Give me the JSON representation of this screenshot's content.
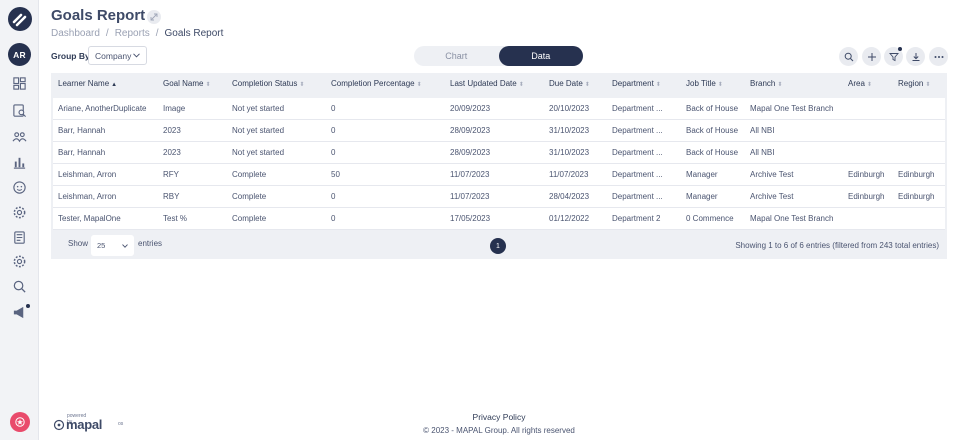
{
  "sidebar": {
    "avatar_initials": "AR",
    "icons": [
      "dashboard-icon",
      "report-search-icon",
      "people-icon",
      "bar-chart-icon",
      "face-icon",
      "settings-icon",
      "document-icon",
      "settings-alt-icon",
      "search-icon",
      "megaphone-icon"
    ]
  },
  "header": {
    "title": "Goals Report",
    "breadcrumb": [
      "Dashboard",
      "Reports",
      "Goals Report"
    ]
  },
  "toolbar": {
    "group_by_label": "Group By",
    "group_by_value": "Company",
    "view_tabs": [
      "Chart",
      "Data"
    ],
    "active_tab": "Data"
  },
  "table": {
    "columns": [
      "Learner Name",
      "Goal Name",
      "Completion Status",
      "Completion Percentage",
      "Last Updated Date",
      "Due Date",
      "Department",
      "Job Title",
      "Branch",
      "Area",
      "Region"
    ],
    "rows": [
      [
        "Ariane, AnotherDuplicate",
        "Image",
        "Not yet started",
        "0",
        "20/09/2023",
        "20/10/2023",
        "Department ...",
        "Back of House",
        "Mapal One Test Branch",
        "",
        ""
      ],
      [
        "Barr, Hannah",
        "2023",
        "Not yet started",
        "0",
        "28/09/2023",
        "31/10/2023",
        "Department ...",
        "Back of House",
        "All NBI",
        "",
        ""
      ],
      [
        "Barr, Hannah",
        "2023",
        "Not yet started",
        "0",
        "28/09/2023",
        "31/10/2023",
        "Department ...",
        "Back of House",
        "All NBI",
        "",
        ""
      ],
      [
        "Leishman, Arron",
        "RFY",
        "Complete",
        "50",
        "11/07/2023",
        "11/07/2023",
        "Department ...",
        "Manager",
        "Archive Test",
        "Edinburgh",
        "Edinburgh"
      ],
      [
        "Leishman, Arron",
        "RBY",
        "Complete",
        "0",
        "11/07/2023",
        "28/04/2023",
        "Department ...",
        "Manager",
        "Archive Test",
        "Edinburgh",
        "Edinburgh"
      ],
      [
        "Tester, MapalOne",
        "Test %",
        "Complete",
        "0",
        "17/05/2023",
        "01/12/2022",
        "Department 2",
        "0 Commence",
        "Mapal One Test Branch",
        "",
        ""
      ]
    ],
    "show_label": "Show",
    "page_size": "25",
    "entries_label": "entries",
    "current_page": "1",
    "info": "Showing 1 to 6 of 6 entries (filtered from 243 total entries)"
  },
  "footer": {
    "powered_by": "powered by",
    "brand": "mapal",
    "brand_suffix": "os",
    "privacy_policy": "Privacy Policy",
    "copyright": "© 2023 - MAPAL Group. All rights reserved"
  },
  "colors": {
    "primary": "#26314f",
    "accent_badge": "#e94a6b",
    "table_bg": "#eef0f4"
  }
}
